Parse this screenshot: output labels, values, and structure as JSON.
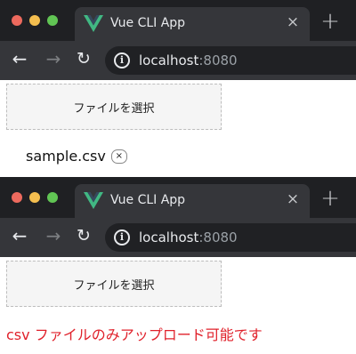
{
  "browser": {
    "tab_title": "Vue CLI App",
    "close_glyph": "×",
    "new_tab_glyph": "+",
    "back_glyph": "←",
    "forward_glyph": "→",
    "reload_glyph": "↻",
    "info_glyph": "i",
    "url_host": "localhost",
    "url_port": ":8080"
  },
  "states": [
    {
      "file_button_label": "ファイルを選択",
      "selected_file": "sample.csv",
      "remove_glyph": "×"
    },
    {
      "file_button_label": "ファイルを選択",
      "error_message": "csv ファイルのみアップロード可能です"
    }
  ],
  "colors": {
    "tab_strip": "#1f2023",
    "toolbar": "#35363a",
    "error": "#e0212b",
    "vue_green": "#41b883",
    "vue_dark": "#35495e"
  },
  "icons": [
    "vue-logo-icon",
    "close-icon",
    "plus-icon",
    "back-arrow-icon",
    "forward-arrow-icon",
    "reload-icon",
    "info-icon"
  ]
}
